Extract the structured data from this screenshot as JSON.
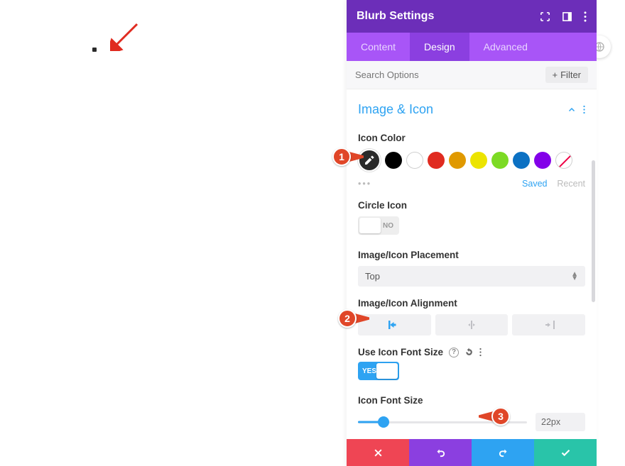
{
  "header": {
    "title": "Blurb Settings"
  },
  "tabs": {
    "content": "Content",
    "design": "Design",
    "advanced": "Advanced",
    "active": "design"
  },
  "search": {
    "placeholder": "Search Options",
    "filter_label": "Filter"
  },
  "section": {
    "title": "Image & Icon"
  },
  "icon_color": {
    "label": "Icon Color",
    "swatches": [
      "#000000",
      "#000000",
      "#ffffff",
      "#e02b20",
      "#edb059",
      "#ece400",
      "#7cda24",
      "#0c71c3",
      "#8300e9",
      "none"
    ],
    "saved": "Saved",
    "recent": "Recent"
  },
  "circle_icon": {
    "label": "Circle Icon",
    "value": "NO"
  },
  "placement": {
    "label": "Image/Icon Placement",
    "value": "Top"
  },
  "alignment": {
    "label": "Image/Icon Alignment"
  },
  "use_font_size": {
    "label": "Use Icon Font Size",
    "value": "YES"
  },
  "font_size": {
    "label": "Icon Font Size",
    "value": "22px"
  },
  "markers": {
    "m1": "1",
    "m2": "2",
    "m3": "3"
  }
}
